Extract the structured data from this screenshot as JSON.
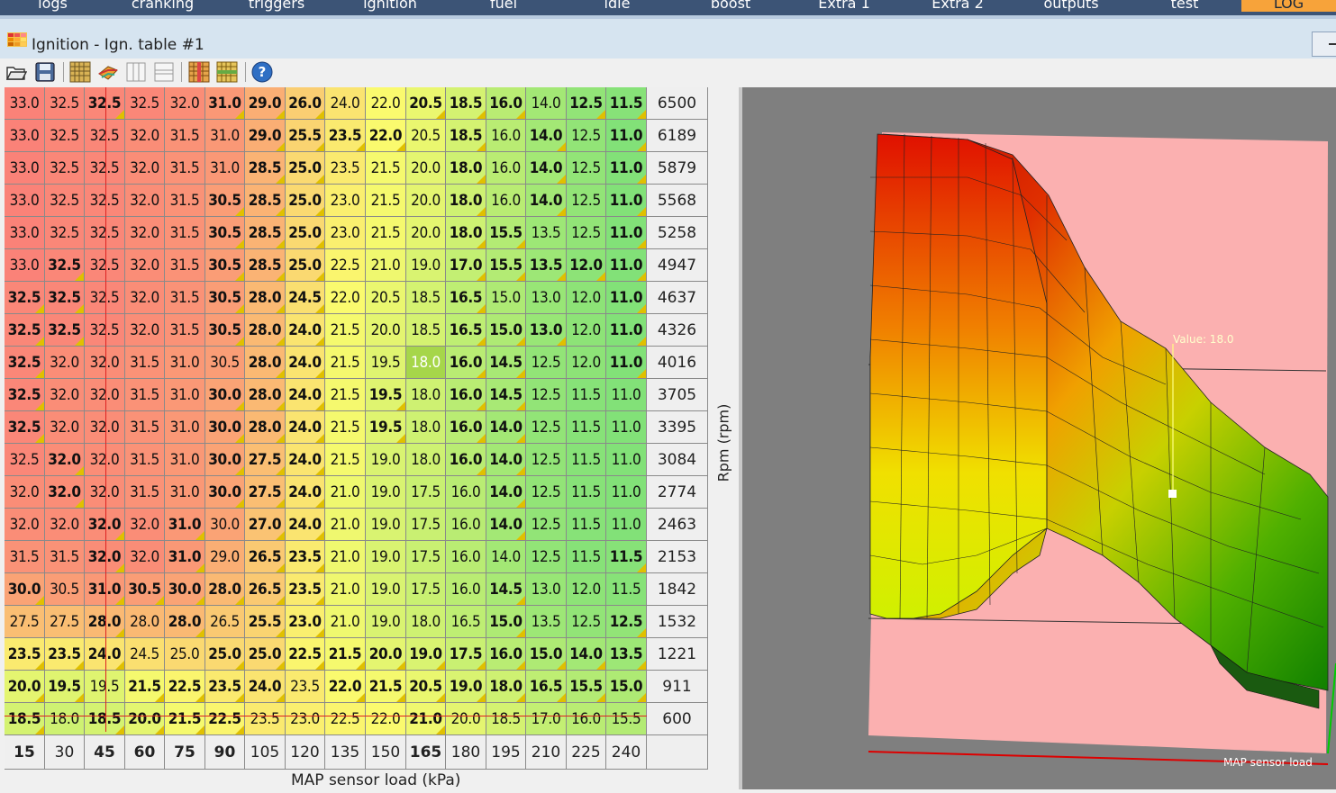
{
  "menu": [
    "logs",
    "cranking",
    "triggers",
    "ignition",
    "fuel",
    "idle",
    "boost",
    "Extra 1",
    "Extra 2",
    "outputs",
    "test",
    "LOG"
  ],
  "menu_active": "LOG",
  "window": {
    "title": "Ignition - Ign. table #1"
  },
  "toolbar": [
    "open-icon",
    "save-icon",
    "grid-view-icon",
    "3d-view-icon",
    "vertical-split-icon",
    "horizontal-split-icon",
    "column-edit-icon",
    "row-edit-icon",
    "help-icon"
  ],
  "table": {
    "x_axis_label": "MAP sensor load (kPa)",
    "y_axis_label": "Rpm (rpm)",
    "load": [
      15,
      30,
      45,
      60,
      75,
      90,
      105,
      120,
      135,
      150,
      165,
      180,
      195,
      210,
      225,
      240
    ],
    "load_bold": [
      true,
      false,
      true,
      true,
      true,
      true,
      false,
      false,
      false,
      false,
      true,
      false,
      false,
      false,
      false,
      false
    ],
    "rpm": [
      6500,
      6189,
      5879,
      5568,
      5258,
      4947,
      4637,
      4326,
      4016,
      3705,
      3395,
      3084,
      2774,
      2463,
      2153,
      1842,
      1532,
      1221,
      911,
      600
    ],
    "values": [
      [
        "33.0",
        "32.5",
        "32.5",
        "32.5",
        "32.0",
        "31.0",
        "29.0",
        "26.0",
        "24.0",
        "22.0",
        "20.5",
        "18.5",
        "16.0",
        "14.0",
        "12.5",
        "11.5"
      ],
      [
        "33.0",
        "32.5",
        "32.5",
        "32.0",
        "31.5",
        "31.0",
        "29.0",
        "25.5",
        "23.5",
        "22.0",
        "20.5",
        "18.5",
        "16.0",
        "14.0",
        "12.5",
        "11.0"
      ],
      [
        "33.0",
        "32.5",
        "32.5",
        "32.0",
        "31.5",
        "31.0",
        "28.5",
        "25.0",
        "23.5",
        "21.5",
        "20.0",
        "18.0",
        "16.0",
        "14.0",
        "12.5",
        "11.0"
      ],
      [
        "33.0",
        "32.5",
        "32.5",
        "32.0",
        "31.5",
        "30.5",
        "28.5",
        "25.0",
        "23.0",
        "21.5",
        "20.0",
        "18.0",
        "16.0",
        "14.0",
        "12.5",
        "11.0"
      ],
      [
        "33.0",
        "32.5",
        "32.5",
        "32.0",
        "31.5",
        "30.5",
        "28.5",
        "25.0",
        "23.0",
        "21.5",
        "20.0",
        "18.0",
        "15.5",
        "13.5",
        "12.5",
        "11.0"
      ],
      [
        "33.0",
        "32.5",
        "32.5",
        "32.0",
        "31.5",
        "30.5",
        "28.5",
        "25.0",
        "22.5",
        "21.0",
        "19.0",
        "17.0",
        "15.5",
        "13.5",
        "12.0",
        "11.0"
      ],
      [
        "32.5",
        "32.5",
        "32.5",
        "32.0",
        "31.5",
        "30.5",
        "28.0",
        "24.5",
        "22.0",
        "20.5",
        "18.5",
        "16.5",
        "15.0",
        "13.0",
        "12.0",
        "11.0"
      ],
      [
        "32.5",
        "32.5",
        "32.5",
        "32.0",
        "31.5",
        "30.5",
        "28.0",
        "24.0",
        "21.5",
        "20.0",
        "18.5",
        "16.5",
        "15.0",
        "13.0",
        "12.0",
        "11.0"
      ],
      [
        "32.5",
        "32.0",
        "32.0",
        "31.5",
        "31.0",
        "30.5",
        "28.0",
        "24.0",
        "21.5",
        "19.5",
        "18.0",
        "16.0",
        "14.5",
        "12.5",
        "12.0",
        "11.0"
      ],
      [
        "32.5",
        "32.0",
        "32.0",
        "31.5",
        "31.0",
        "30.0",
        "28.0",
        "24.0",
        "21.5",
        "19.5",
        "18.0",
        "16.0",
        "14.5",
        "12.5",
        "11.5",
        "11.0"
      ],
      [
        "32.5",
        "32.0",
        "32.0",
        "31.5",
        "31.0",
        "30.0",
        "28.0",
        "24.0",
        "21.5",
        "19.5",
        "18.0",
        "16.0",
        "14.0",
        "12.5",
        "11.5",
        "11.0"
      ],
      [
        "32.5",
        "32.0",
        "32.0",
        "31.5",
        "31.0",
        "30.0",
        "27.5",
        "24.0",
        "21.5",
        "19.0",
        "18.0",
        "16.0",
        "14.0",
        "12.5",
        "11.5",
        "11.0"
      ],
      [
        "32.0",
        "32.0",
        "32.0",
        "31.5",
        "31.0",
        "30.0",
        "27.5",
        "24.0",
        "21.0",
        "19.0",
        "17.5",
        "16.0",
        "14.0",
        "12.5",
        "11.5",
        "11.0"
      ],
      [
        "32.0",
        "32.0",
        "32.0",
        "32.0",
        "31.0",
        "30.0",
        "27.0",
        "24.0",
        "21.0",
        "19.0",
        "17.5",
        "16.0",
        "14.0",
        "12.5",
        "11.5",
        "11.0"
      ],
      [
        "31.5",
        "31.5",
        "32.0",
        "32.0",
        "31.0",
        "29.0",
        "26.5",
        "23.5",
        "21.0",
        "19.0",
        "17.5",
        "16.0",
        "14.0",
        "12.5",
        "11.5",
        "11.5"
      ],
      [
        "30.0",
        "30.5",
        "31.0",
        "30.5",
        "30.0",
        "28.0",
        "26.5",
        "23.5",
        "21.0",
        "19.0",
        "17.5",
        "16.0",
        "14.5",
        "13.0",
        "12.0",
        "11.5"
      ],
      [
        "27.5",
        "27.5",
        "28.0",
        "28.0",
        "28.0",
        "26.5",
        "25.5",
        "23.0",
        "21.0",
        "19.0",
        "18.0",
        "16.5",
        "15.0",
        "13.5",
        "12.5",
        "12.5"
      ],
      [
        "23.5",
        "23.5",
        "24.0",
        "24.5",
        "25.0",
        "25.0",
        "25.0",
        "22.5",
        "21.5",
        "20.0",
        "19.0",
        "17.5",
        "16.0",
        "15.0",
        "14.0",
        "13.5"
      ],
      [
        "20.0",
        "19.5",
        "19.5",
        "21.5",
        "22.5",
        "23.5",
        "24.0",
        "23.5",
        "22.0",
        "21.5",
        "20.5",
        "19.0",
        "18.0",
        "16.5",
        "15.5",
        "15.0"
      ],
      [
        "18.5",
        "18.0",
        "18.5",
        "20.0",
        "21.5",
        "22.5",
        "23.5",
        "23.0",
        "22.5",
        "22.0",
        "21.0",
        "20.0",
        "18.5",
        "17.0",
        "16.0",
        "15.5"
      ]
    ],
    "bold": [
      [
        0,
        0,
        1,
        0,
        0,
        1,
        1,
        1,
        0,
        0,
        1,
        1,
        1,
        0,
        1,
        1
      ],
      [
        0,
        0,
        0,
        0,
        0,
        0,
        1,
        1,
        1,
        1,
        0,
        1,
        0,
        1,
        0,
        1
      ],
      [
        0,
        0,
        0,
        0,
        0,
        0,
        1,
        1,
        0,
        0,
        0,
        1,
        0,
        1,
        0,
        1
      ],
      [
        0,
        0,
        0,
        0,
        0,
        1,
        1,
        1,
        0,
        0,
        0,
        1,
        0,
        1,
        0,
        1
      ],
      [
        0,
        0,
        0,
        0,
        0,
        1,
        1,
        1,
        0,
        0,
        0,
        1,
        1,
        0,
        0,
        1
      ],
      [
        0,
        1,
        0,
        0,
        0,
        1,
        1,
        1,
        0,
        0,
        0,
        1,
        1,
        1,
        1,
        1
      ],
      [
        1,
        1,
        0,
        0,
        0,
        1,
        1,
        1,
        0,
        0,
        0,
        1,
        0,
        0,
        0,
        1
      ],
      [
        1,
        1,
        0,
        0,
        0,
        1,
        1,
        1,
        0,
        0,
        0,
        1,
        1,
        1,
        0,
        1
      ],
      [
        1,
        0,
        0,
        0,
        0,
        0,
        1,
        1,
        0,
        0,
        0,
        1,
        1,
        0,
        0,
        1
      ],
      [
        1,
        0,
        0,
        0,
        0,
        1,
        1,
        1,
        0,
        1,
        0,
        1,
        1,
        0,
        0,
        0
      ],
      [
        1,
        0,
        0,
        0,
        0,
        1,
        1,
        1,
        0,
        1,
        0,
        1,
        1,
        0,
        0,
        0
      ],
      [
        0,
        1,
        0,
        0,
        0,
        1,
        1,
        1,
        0,
        0,
        0,
        1,
        1,
        0,
        0,
        0
      ],
      [
        0,
        1,
        0,
        0,
        0,
        1,
        1,
        1,
        0,
        0,
        0,
        0,
        1,
        0,
        0,
        0
      ],
      [
        0,
        0,
        1,
        0,
        1,
        0,
        1,
        1,
        0,
        0,
        0,
        0,
        1,
        0,
        0,
        0
      ],
      [
        0,
        0,
        1,
        0,
        1,
        0,
        1,
        1,
        0,
        0,
        0,
        0,
        0,
        0,
        0,
        1
      ],
      [
        1,
        0,
        1,
        1,
        1,
        1,
        1,
        1,
        0,
        0,
        0,
        0,
        1,
        0,
        0,
        0
      ],
      [
        0,
        0,
        1,
        0,
        1,
        0,
        1,
        1,
        0,
        0,
        0,
        0,
        1,
        0,
        0,
        1
      ],
      [
        1,
        1,
        1,
        0,
        0,
        1,
        1,
        1,
        1,
        1,
        1,
        1,
        1,
        1,
        1,
        1
      ],
      [
        1,
        1,
        0,
        1,
        1,
        1,
        1,
        0,
        1,
        1,
        1,
        1,
        1,
        1,
        1,
        1
      ],
      [
        1,
        0,
        1,
        1,
        1,
        1,
        0,
        0,
        0,
        0,
        1,
        0,
        0,
        0,
        0,
        0
      ]
    ],
    "selected": {
      "row": 8,
      "col": 10
    },
    "cursor": {
      "row": 19,
      "col": 2
    }
  },
  "view3d": {
    "value_label": "Value: 18.0",
    "axis_label": "MAP sensor load"
  }
}
